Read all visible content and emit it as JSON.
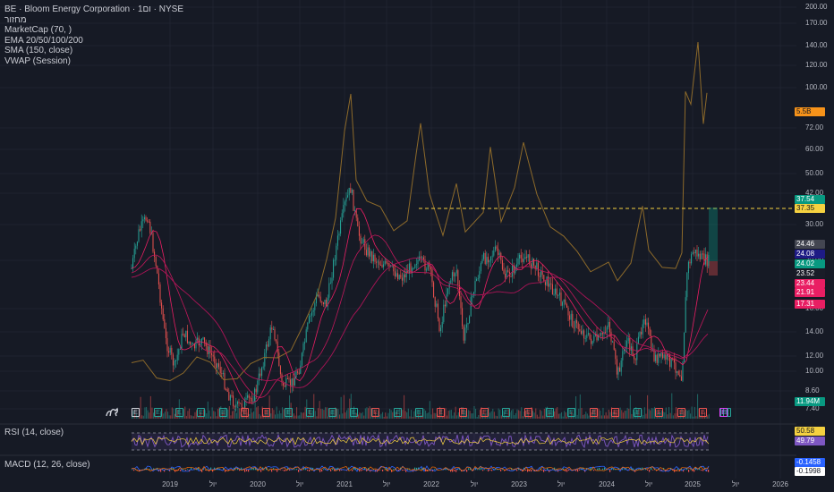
{
  "legend": {
    "title": "BE · Bloom Energy Corporation · 1ום · NYSE",
    "line2": "מחזור",
    "line3": "MarketCap (70, )",
    "line4": "EMA 20/50/100/200",
    "line5": "SMA (150, close)",
    "line6": "VWAP (Session)"
  },
  "rsi_label": "RSI (14, close)",
  "macd_label": "MACD (12, 26, close)",
  "y_axis": [
    "200.00",
    "170.00",
    "140.00",
    "120.00",
    "100.00",
    "72.00",
    "60.00",
    "50.00",
    "42.00",
    "30.00",
    "20.00",
    "16.00",
    "14.00",
    "12.00",
    "10.00",
    "8.60",
    "7.40"
  ],
  "x_axis": [
    "2019",
    "יול",
    "2020",
    "יול",
    "2021",
    "יול",
    "2022",
    "יול",
    "2023",
    "יול",
    "2024",
    "יול",
    "2025",
    "יול",
    "2026"
  ],
  "price_tags": {
    "mcap": "5.5B",
    "t1": "37.54",
    "t2": "37.35",
    "t3": "24.46",
    "t4": "24.08",
    "t5": "24.02",
    "t6": "23.52",
    "t7": "23.44",
    "t8": "21.91",
    "t9": "17.31",
    "vol": "11.94M",
    "rsi1": "50.58",
    "rsi2": "49.79",
    "macd1": "-0.1458",
    "macd2": "-0.1998"
  },
  "events": [
    "E",
    "E",
    "E",
    "E",
    "E",
    "E",
    "E",
    "E",
    "E",
    "E",
    "E",
    "E",
    "E",
    "E",
    "E",
    "E",
    "E",
    "E",
    "E",
    "E",
    "E",
    "E",
    "E",
    "E",
    "E",
    "E",
    "E",
    "E",
    "E",
    "E",
    "E",
    "E"
  ],
  "event_colors": [
    "w",
    "g",
    "g",
    "g",
    "g",
    "r",
    "r",
    "g",
    "g",
    "g",
    "g",
    "r",
    "g",
    "g",
    "r",
    "r",
    "r",
    "g",
    "r",
    "g",
    "g",
    "r",
    "r",
    "g",
    "r",
    "r",
    "r",
    "g",
    "g",
    "r",
    "g",
    "m"
  ],
  "colors": {
    "background": "#161a25",
    "up": "#26a69a",
    "down": "#ef5350",
    "marketcap": "#8d6a2a",
    "ema": "#e91e63",
    "rsi": "#7e57c2",
    "dashed_level": "#f5d140"
  },
  "icons": {
    "logo": "tradingview-logo-icon"
  }
}
